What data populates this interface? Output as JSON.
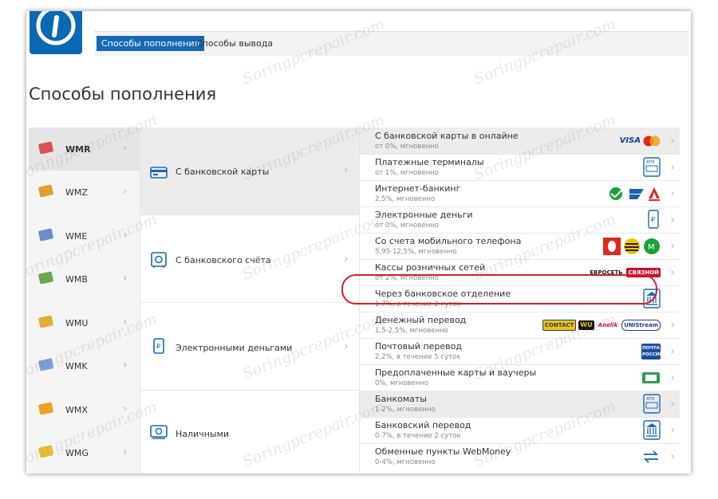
{
  "header": {
    "tabs": [
      {
        "label": "Способы пополнения",
        "active": true
      },
      {
        "label": "Способы вывода",
        "active": false
      }
    ]
  },
  "page": {
    "title": "Способы пополнения"
  },
  "wallets": [
    {
      "label": "WMR",
      "active": true,
      "color": "#d9534f"
    },
    {
      "label": "WMZ",
      "active": false,
      "color": "#e0a030"
    },
    {
      "label": "WME",
      "active": false,
      "color": "#6a8fd0"
    },
    {
      "label": "WMB",
      "active": false,
      "color": "#6aa84f"
    },
    {
      "label": "WMU",
      "active": false,
      "color": "#e0b030"
    },
    {
      "label": "WMK",
      "active": false,
      "color": "#7aa0d8"
    },
    {
      "label": "WMX",
      "active": false,
      "color": "#f0a020"
    },
    {
      "label": "WMG",
      "active": false,
      "color": "#e8c030"
    }
  ],
  "categories": [
    {
      "label": "С банковской карты",
      "icon": "bank-card-icon",
      "active": true
    },
    {
      "label": "С банковского счёта",
      "icon": "bank-safe-icon",
      "active": false
    },
    {
      "label": "Электронными деньгами",
      "icon": "e-money-icon",
      "active": false
    },
    {
      "label": "Наличными",
      "icon": "cash-icon",
      "active": false
    }
  ],
  "methods": [
    {
      "name": "С банковской карты в онлайне",
      "fee": "от 0%, мгновенно",
      "logos": [
        "VISA",
        "MasterCard"
      ]
    },
    {
      "name": "Платежные терминалы",
      "fee": "от 1%, мгновенно",
      "logos": [
        "ATM"
      ]
    },
    {
      "name": "Интернет-банкинг",
      "fee": "2,5%, мгновенно",
      "logos": [
        "sberbank",
        "vtb24",
        "alfa"
      ]
    },
    {
      "name": "Электронные деньги",
      "fee": "от 0%, мгновенно",
      "logos": [
        "e-wallet"
      ]
    },
    {
      "name": "Со счета мобильного телефона",
      "fee": "5,95-12,5%, мгновенно",
      "logos": [
        "mts",
        "beeline",
        "megafon"
      ]
    },
    {
      "name": "Кассы розничных сетей",
      "fee": "от 2%, мгновенно",
      "logos": [
        "ЕВРОСЕТЬ",
        "СВЯЗНОЙ"
      ]
    },
    {
      "name": "Через банковское отделение",
      "fee": "1-7%, в течение 2 суток",
      "logos": [
        "BANK"
      ]
    },
    {
      "name": "Денежный перевод",
      "fee": "1,5-2,5%, мгновенно",
      "logos": [
        "CONTACT",
        "WU",
        "Anelik",
        "UNIStream"
      ]
    },
    {
      "name": "Почтовый перевод",
      "fee": "2,2%, в течение 5 суток",
      "logos": [
        "ПОЧТА РОССИИ"
      ]
    },
    {
      "name": "Предоплаченные карты и ваучеры",
      "fee": "0%, мгновенно",
      "logos": [
        "voucher"
      ]
    },
    {
      "name": "Банкоматы",
      "fee": "1-2%, мгновенно",
      "logos": [
        "ATM"
      ]
    },
    {
      "name": "Банковский перевод",
      "fee": "0-7%, в течение 2 суток",
      "logos": [
        "BANK"
      ]
    },
    {
      "name": "Обменные пункты WebMoney",
      "fee": "0-4%, мгновенно",
      "logos": [
        "exchange"
      ]
    }
  ],
  "watermark": "Soringpcrepair.com",
  "colors": {
    "accent": "#1669b5",
    "logo_bg": "#0b68b3",
    "highlight": "#d11e2a"
  }
}
